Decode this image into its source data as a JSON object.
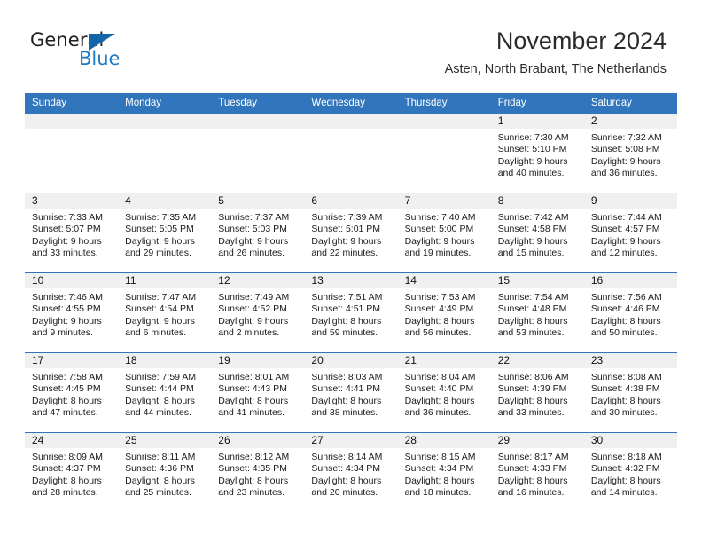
{
  "brand": {
    "name_part1": "General",
    "name_part2": "Blue",
    "triangle_color": "#1464aa",
    "blue_color": "#1e7bc4"
  },
  "header": {
    "title": "November 2024",
    "subtitle": "Asten, North Brabant, The Netherlands",
    "accent_color": "#3176bd",
    "daynum_band_color": "#f0f0f0"
  },
  "calendar": {
    "weekday_headers": [
      "Sunday",
      "Monday",
      "Tuesday",
      "Wednesday",
      "Thursday",
      "Friday",
      "Saturday"
    ],
    "weeks": [
      [
        {
          "day": "",
          "sunrise": "",
          "sunset": "",
          "daylight_l1": "",
          "daylight_l2": ""
        },
        {
          "day": "",
          "sunrise": "",
          "sunset": "",
          "daylight_l1": "",
          "daylight_l2": ""
        },
        {
          "day": "",
          "sunrise": "",
          "sunset": "",
          "daylight_l1": "",
          "daylight_l2": ""
        },
        {
          "day": "",
          "sunrise": "",
          "sunset": "",
          "daylight_l1": "",
          "daylight_l2": ""
        },
        {
          "day": "",
          "sunrise": "",
          "sunset": "",
          "daylight_l1": "",
          "daylight_l2": ""
        },
        {
          "day": "1",
          "sunrise": "Sunrise: 7:30 AM",
          "sunset": "Sunset: 5:10 PM",
          "daylight_l1": "Daylight: 9 hours",
          "daylight_l2": "and 40 minutes."
        },
        {
          "day": "2",
          "sunrise": "Sunrise: 7:32 AM",
          "sunset": "Sunset: 5:08 PM",
          "daylight_l1": "Daylight: 9 hours",
          "daylight_l2": "and 36 minutes."
        }
      ],
      [
        {
          "day": "3",
          "sunrise": "Sunrise: 7:33 AM",
          "sunset": "Sunset: 5:07 PM",
          "daylight_l1": "Daylight: 9 hours",
          "daylight_l2": "and 33 minutes."
        },
        {
          "day": "4",
          "sunrise": "Sunrise: 7:35 AM",
          "sunset": "Sunset: 5:05 PM",
          "daylight_l1": "Daylight: 9 hours",
          "daylight_l2": "and 29 minutes."
        },
        {
          "day": "5",
          "sunrise": "Sunrise: 7:37 AM",
          "sunset": "Sunset: 5:03 PM",
          "daylight_l1": "Daylight: 9 hours",
          "daylight_l2": "and 26 minutes."
        },
        {
          "day": "6",
          "sunrise": "Sunrise: 7:39 AM",
          "sunset": "Sunset: 5:01 PM",
          "daylight_l1": "Daylight: 9 hours",
          "daylight_l2": "and 22 minutes."
        },
        {
          "day": "7",
          "sunrise": "Sunrise: 7:40 AM",
          "sunset": "Sunset: 5:00 PM",
          "daylight_l1": "Daylight: 9 hours",
          "daylight_l2": "and 19 minutes."
        },
        {
          "day": "8",
          "sunrise": "Sunrise: 7:42 AM",
          "sunset": "Sunset: 4:58 PM",
          "daylight_l1": "Daylight: 9 hours",
          "daylight_l2": "and 15 minutes."
        },
        {
          "day": "9",
          "sunrise": "Sunrise: 7:44 AM",
          "sunset": "Sunset: 4:57 PM",
          "daylight_l1": "Daylight: 9 hours",
          "daylight_l2": "and 12 minutes."
        }
      ],
      [
        {
          "day": "10",
          "sunrise": "Sunrise: 7:46 AM",
          "sunset": "Sunset: 4:55 PM",
          "daylight_l1": "Daylight: 9 hours",
          "daylight_l2": "and 9 minutes."
        },
        {
          "day": "11",
          "sunrise": "Sunrise: 7:47 AM",
          "sunset": "Sunset: 4:54 PM",
          "daylight_l1": "Daylight: 9 hours",
          "daylight_l2": "and 6 minutes."
        },
        {
          "day": "12",
          "sunrise": "Sunrise: 7:49 AM",
          "sunset": "Sunset: 4:52 PM",
          "daylight_l1": "Daylight: 9 hours",
          "daylight_l2": "and 2 minutes."
        },
        {
          "day": "13",
          "sunrise": "Sunrise: 7:51 AM",
          "sunset": "Sunset: 4:51 PM",
          "daylight_l1": "Daylight: 8 hours",
          "daylight_l2": "and 59 minutes."
        },
        {
          "day": "14",
          "sunrise": "Sunrise: 7:53 AM",
          "sunset": "Sunset: 4:49 PM",
          "daylight_l1": "Daylight: 8 hours",
          "daylight_l2": "and 56 minutes."
        },
        {
          "day": "15",
          "sunrise": "Sunrise: 7:54 AM",
          "sunset": "Sunset: 4:48 PM",
          "daylight_l1": "Daylight: 8 hours",
          "daylight_l2": "and 53 minutes."
        },
        {
          "day": "16",
          "sunrise": "Sunrise: 7:56 AM",
          "sunset": "Sunset: 4:46 PM",
          "daylight_l1": "Daylight: 8 hours",
          "daylight_l2": "and 50 minutes."
        }
      ],
      [
        {
          "day": "17",
          "sunrise": "Sunrise: 7:58 AM",
          "sunset": "Sunset: 4:45 PM",
          "daylight_l1": "Daylight: 8 hours",
          "daylight_l2": "and 47 minutes."
        },
        {
          "day": "18",
          "sunrise": "Sunrise: 7:59 AM",
          "sunset": "Sunset: 4:44 PM",
          "daylight_l1": "Daylight: 8 hours",
          "daylight_l2": "and 44 minutes."
        },
        {
          "day": "19",
          "sunrise": "Sunrise: 8:01 AM",
          "sunset": "Sunset: 4:43 PM",
          "daylight_l1": "Daylight: 8 hours",
          "daylight_l2": "and 41 minutes."
        },
        {
          "day": "20",
          "sunrise": "Sunrise: 8:03 AM",
          "sunset": "Sunset: 4:41 PM",
          "daylight_l1": "Daylight: 8 hours",
          "daylight_l2": "and 38 minutes."
        },
        {
          "day": "21",
          "sunrise": "Sunrise: 8:04 AM",
          "sunset": "Sunset: 4:40 PM",
          "daylight_l1": "Daylight: 8 hours",
          "daylight_l2": "and 36 minutes."
        },
        {
          "day": "22",
          "sunrise": "Sunrise: 8:06 AM",
          "sunset": "Sunset: 4:39 PM",
          "daylight_l1": "Daylight: 8 hours",
          "daylight_l2": "and 33 minutes."
        },
        {
          "day": "23",
          "sunrise": "Sunrise: 8:08 AM",
          "sunset": "Sunset: 4:38 PM",
          "daylight_l1": "Daylight: 8 hours",
          "daylight_l2": "and 30 minutes."
        }
      ],
      [
        {
          "day": "24",
          "sunrise": "Sunrise: 8:09 AM",
          "sunset": "Sunset: 4:37 PM",
          "daylight_l1": "Daylight: 8 hours",
          "daylight_l2": "and 28 minutes."
        },
        {
          "day": "25",
          "sunrise": "Sunrise: 8:11 AM",
          "sunset": "Sunset: 4:36 PM",
          "daylight_l1": "Daylight: 8 hours",
          "daylight_l2": "and 25 minutes."
        },
        {
          "day": "26",
          "sunrise": "Sunrise: 8:12 AM",
          "sunset": "Sunset: 4:35 PM",
          "daylight_l1": "Daylight: 8 hours",
          "daylight_l2": "and 23 minutes."
        },
        {
          "day": "27",
          "sunrise": "Sunrise: 8:14 AM",
          "sunset": "Sunset: 4:34 PM",
          "daylight_l1": "Daylight: 8 hours",
          "daylight_l2": "and 20 minutes."
        },
        {
          "day": "28",
          "sunrise": "Sunrise: 8:15 AM",
          "sunset": "Sunset: 4:34 PM",
          "daylight_l1": "Daylight: 8 hours",
          "daylight_l2": "and 18 minutes."
        },
        {
          "day": "29",
          "sunrise": "Sunrise: 8:17 AM",
          "sunset": "Sunset: 4:33 PM",
          "daylight_l1": "Daylight: 8 hours",
          "daylight_l2": "and 16 minutes."
        },
        {
          "day": "30",
          "sunrise": "Sunrise: 8:18 AM",
          "sunset": "Sunset: 4:32 PM",
          "daylight_l1": "Daylight: 8 hours",
          "daylight_l2": "and 14 minutes."
        }
      ]
    ]
  }
}
